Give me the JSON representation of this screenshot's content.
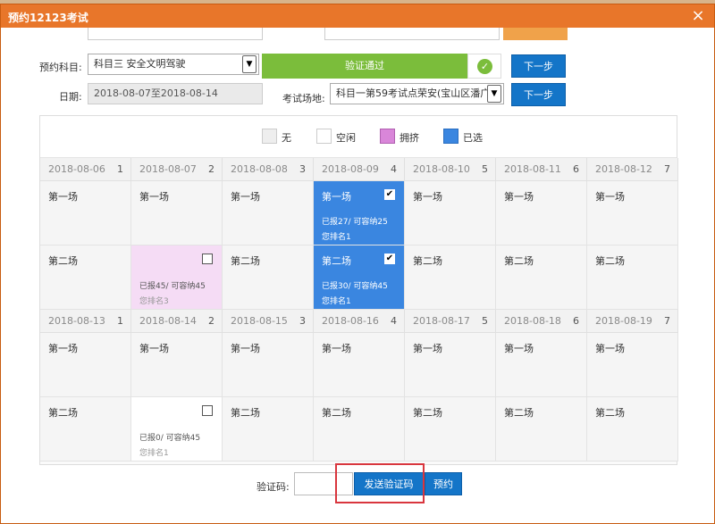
{
  "dialog": {
    "title": "预约12123考试",
    "close_symbol": "×"
  },
  "form": {
    "subject_label": "预约科目:",
    "subject_value": "科目三 安全文明驾驶",
    "verify_status": "验证通过",
    "next_label": "下一步",
    "date_label": "日期:",
    "date_value": "2018-08-07至2018-08-14",
    "venue_label": "考试场地:",
    "venue_value": "科目一第59考试点荣安(宝山区潘广",
    "next2_label": "下一步"
  },
  "legend": [
    {
      "label": "无",
      "color": "#eeeeee"
    },
    {
      "label": "空闲",
      "color": "#ffffff"
    },
    {
      "label": "拥挤",
      "color": "#d986d9"
    },
    {
      "label": "已选",
      "color": "#3a86e0"
    }
  ],
  "weeks": [
    {
      "days": [
        {
          "date": "2018-08-06",
          "num": "1"
        },
        {
          "date": "2018-08-07",
          "num": "2"
        },
        {
          "date": "2018-08-08",
          "num": "3"
        },
        {
          "date": "2018-08-09",
          "num": "4"
        },
        {
          "date": "2018-08-10",
          "num": "5"
        },
        {
          "date": "2018-08-11",
          "num": "6"
        },
        {
          "date": "2018-08-12",
          "num": "7"
        }
      ],
      "rows": [
        [
          {
            "label": "第一场",
            "state": "none"
          },
          {
            "label": "第一场",
            "state": "none"
          },
          {
            "label": "第一场",
            "state": "none"
          },
          {
            "label": "第一场",
            "state": "selected",
            "check": "✔",
            "info1": "已报27/ 可容纳25",
            "info2": "您排名1"
          },
          {
            "label": "第一场",
            "state": "none"
          },
          {
            "label": "第一场",
            "state": "none"
          },
          {
            "label": "第一场",
            "state": "none"
          }
        ],
        [
          {
            "label": "第二场",
            "state": "none"
          },
          {
            "label": "",
            "state": "crowded",
            "check": "",
            "info1": "已报45/ 可容纳45",
            "info2": "您排名3"
          },
          {
            "label": "第二场",
            "state": "none"
          },
          {
            "label": "第二场",
            "state": "selected",
            "check": "✔",
            "info1": "已报30/ 可容纳45",
            "info2": "您排名1"
          },
          {
            "label": "第二场",
            "state": "none"
          },
          {
            "label": "第二场",
            "state": "none"
          },
          {
            "label": "第二场",
            "state": "none"
          }
        ]
      ]
    },
    {
      "days": [
        {
          "date": "2018-08-13",
          "num": "1"
        },
        {
          "date": "2018-08-14",
          "num": "2"
        },
        {
          "date": "2018-08-15",
          "num": "3"
        },
        {
          "date": "2018-08-16",
          "num": "4"
        },
        {
          "date": "2018-08-17",
          "num": "5"
        },
        {
          "date": "2018-08-18",
          "num": "6"
        },
        {
          "date": "2018-08-19",
          "num": "7"
        }
      ],
      "rows": [
        [
          {
            "label": "第一场",
            "state": "none"
          },
          {
            "label": "第一场",
            "state": "none"
          },
          {
            "label": "第一场",
            "state": "none"
          },
          {
            "label": "第一场",
            "state": "none"
          },
          {
            "label": "第一场",
            "state": "none"
          },
          {
            "label": "第一场",
            "state": "none"
          },
          {
            "label": "第一场",
            "state": "none"
          }
        ],
        [
          {
            "label": "第二场",
            "state": "none"
          },
          {
            "label": "",
            "state": "free",
            "check": "",
            "info1": "已报0/ 可容纳45",
            "info2": "您排名1"
          },
          {
            "label": "第二场",
            "state": "none"
          },
          {
            "label": "第二场",
            "state": "none"
          },
          {
            "label": "第二场",
            "state": "none"
          },
          {
            "label": "第二场",
            "state": "none"
          },
          {
            "label": "第二场",
            "state": "none"
          }
        ]
      ]
    }
  ],
  "bottom": {
    "code_label": "验证码:",
    "code_value": "",
    "send_code_label": "发送验证码",
    "book_label": "预约"
  }
}
